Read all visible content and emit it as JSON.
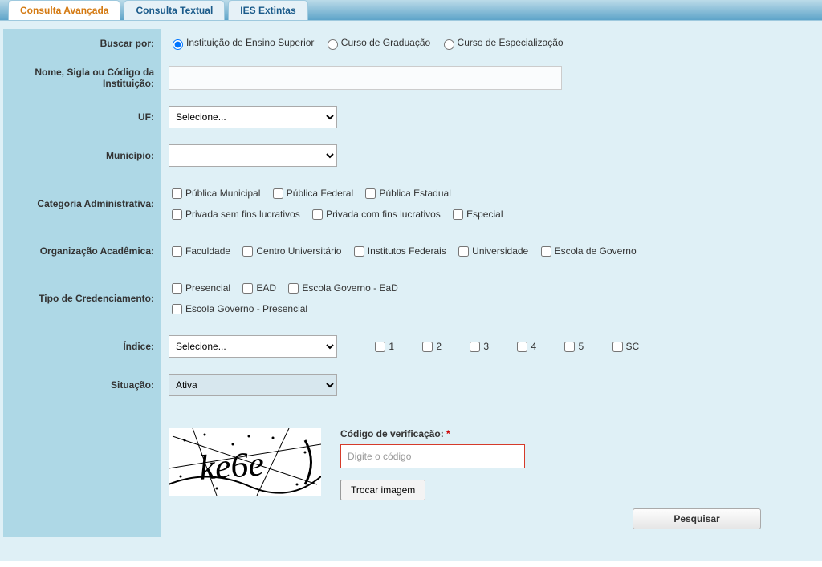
{
  "tabs": [
    {
      "label": "Consulta Avançada",
      "active": true
    },
    {
      "label": "Consulta Textual",
      "active": false
    },
    {
      "label": "IES Extintas",
      "active": false
    }
  ],
  "labels": {
    "buscar_por": "Buscar por:",
    "nome_sigla": "Nome, Sigla ou Código da Instituição:",
    "uf": "UF:",
    "municipio": "Município:",
    "categoria": "Categoria Administrativa:",
    "organizacao": "Organização Acadêmica:",
    "tipo_cred": "Tipo de Credenciamento:",
    "indice": "Índice:",
    "situacao": "Situação:"
  },
  "buscar_por_options": [
    {
      "label": "Instituição de Ensino Superior",
      "checked": true
    },
    {
      "label": "Curso de Graduação",
      "checked": false
    },
    {
      "label": "Curso de Especialização",
      "checked": false
    }
  ],
  "nome_value": "",
  "uf_selected": "Selecione...",
  "municipio_selected": "",
  "categoria_options": [
    "Pública Municipal",
    "Pública Federal",
    "Pública Estadual",
    "Privada sem fins lucrativos",
    "Privada com fins lucrativos",
    "Especial"
  ],
  "organizacao_options": [
    "Faculdade",
    "Centro Universitário",
    "Institutos Federais",
    "Universidade",
    "Escola de Governo"
  ],
  "tipo_cred_options": [
    "Presencial",
    "EAD",
    "Escola Governo - EaD",
    "Escola Governo - Presencial"
  ],
  "indice_selected": "Selecione...",
  "indice_values": [
    "1",
    "2",
    "3",
    "4",
    "5",
    "SC"
  ],
  "situacao_selected": "Ativa",
  "captcha": {
    "text": "ke6e",
    "label": "Código de verificação:",
    "required_mark": "*",
    "placeholder": "Digite o código",
    "swap_label": "Trocar imagem"
  },
  "search_label": "Pesquisar"
}
